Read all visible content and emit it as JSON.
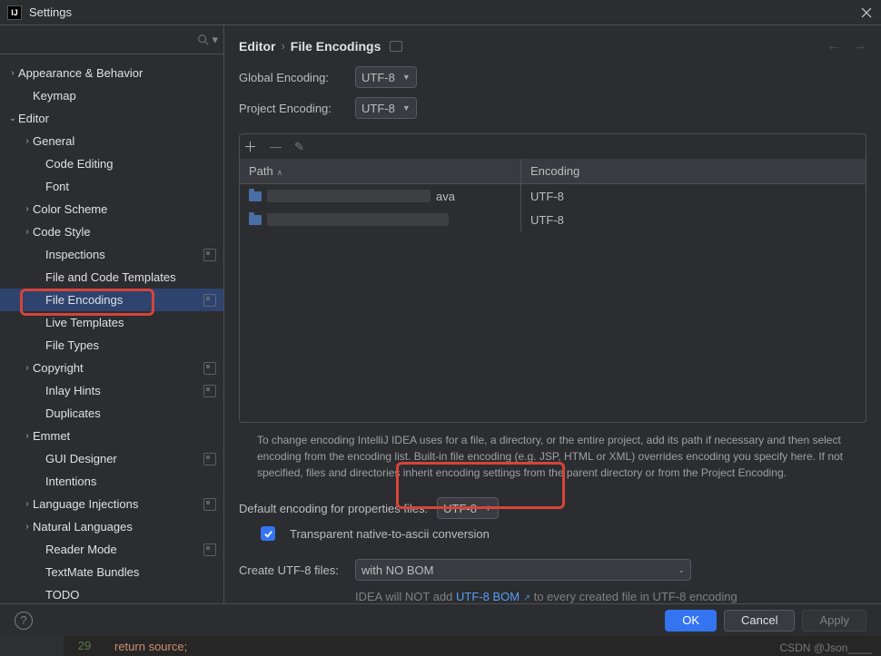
{
  "window": {
    "title": "Settings"
  },
  "search": {
    "placeholder": ""
  },
  "tree": [
    {
      "label": "Appearance & Behavior",
      "level": 0,
      "arrow": "›",
      "sel": false
    },
    {
      "label": "Keymap",
      "level": 1,
      "arrow": "",
      "sel": false
    },
    {
      "label": "Editor",
      "level": 0,
      "arrow": "⌄",
      "sel": false
    },
    {
      "label": "General",
      "level": 1,
      "arrow": "›",
      "sel": false
    },
    {
      "label": "Code Editing",
      "level": 2,
      "arrow": "",
      "sel": false
    },
    {
      "label": "Font",
      "level": 2,
      "arrow": "",
      "sel": false
    },
    {
      "label": "Color Scheme",
      "level": 1,
      "arrow": "›",
      "sel": false
    },
    {
      "label": "Code Style",
      "level": 1,
      "arrow": "›",
      "sel": false
    },
    {
      "label": "Inspections",
      "level": 2,
      "arrow": "",
      "sel": false,
      "glyph": true
    },
    {
      "label": "File and Code Templates",
      "level": 2,
      "arrow": "",
      "sel": false
    },
    {
      "label": "File Encodings",
      "level": 2,
      "arrow": "",
      "sel": true,
      "glyph": true
    },
    {
      "label": "Live Templates",
      "level": 2,
      "arrow": "",
      "sel": false
    },
    {
      "label": "File Types",
      "level": 2,
      "arrow": "",
      "sel": false
    },
    {
      "label": "Copyright",
      "level": 1,
      "arrow": "›",
      "sel": false,
      "glyph": true
    },
    {
      "label": "Inlay Hints",
      "level": 2,
      "arrow": "",
      "sel": false,
      "glyph": true
    },
    {
      "label": "Duplicates",
      "level": 2,
      "arrow": "",
      "sel": false
    },
    {
      "label": "Emmet",
      "level": 1,
      "arrow": "›",
      "sel": false
    },
    {
      "label": "GUI Designer",
      "level": 2,
      "arrow": "",
      "sel": false,
      "glyph": true
    },
    {
      "label": "Intentions",
      "level": 2,
      "arrow": "",
      "sel": false
    },
    {
      "label": "Language Injections",
      "level": 1,
      "arrow": "›",
      "sel": false,
      "glyph": true
    },
    {
      "label": "Natural Languages",
      "level": 1,
      "arrow": "›",
      "sel": false
    },
    {
      "label": "Reader Mode",
      "level": 2,
      "arrow": "",
      "sel": false,
      "glyph": true
    },
    {
      "label": "TextMate Bundles",
      "level": 2,
      "arrow": "",
      "sel": false
    },
    {
      "label": "TODO",
      "level": 2,
      "arrow": "",
      "sel": false
    }
  ],
  "breadcrumb": {
    "a": "Editor",
    "b": "File Encodings"
  },
  "encodings": {
    "global_label": "Global Encoding:",
    "global_value": "UTF-8",
    "project_label": "Project Encoding:",
    "project_value": "UTF-8",
    "props_label": "Default encoding for properties files:",
    "props_value": "UTF-8",
    "transparent_label": "Transparent native-to-ascii conversion",
    "bom_label": "Create UTF-8 files:",
    "bom_value": "with NO BOM",
    "hint_pre": "IDEA will NOT add ",
    "hint_link": "UTF-8 BOM",
    "hint_post": " to every created file in UTF-8 encoding"
  },
  "table": {
    "col_path": "Path",
    "col_enc": "Encoding",
    "rows": [
      {
        "path_suffix": "ava",
        "enc": "UTF-8"
      },
      {
        "path_suffix": "",
        "enc": "UTF-8"
      }
    ]
  },
  "help_text": "To change encoding IntelliJ IDEA uses for a file, a directory, or the entire project, add its path if necessary and then select encoding from the encoding list. Built-in file encoding (e.g. JSP, HTML or XML) overrides encoding you specify here. If not specified, files and directories inherit encoding settings from the parent directory or from the Project Encoding.",
  "buttons": {
    "ok": "OK",
    "cancel": "Cancel",
    "apply": "Apply"
  },
  "editor_strip": {
    "line": "29",
    "code": "return source;"
  },
  "watermark": "CSDN @Json____"
}
